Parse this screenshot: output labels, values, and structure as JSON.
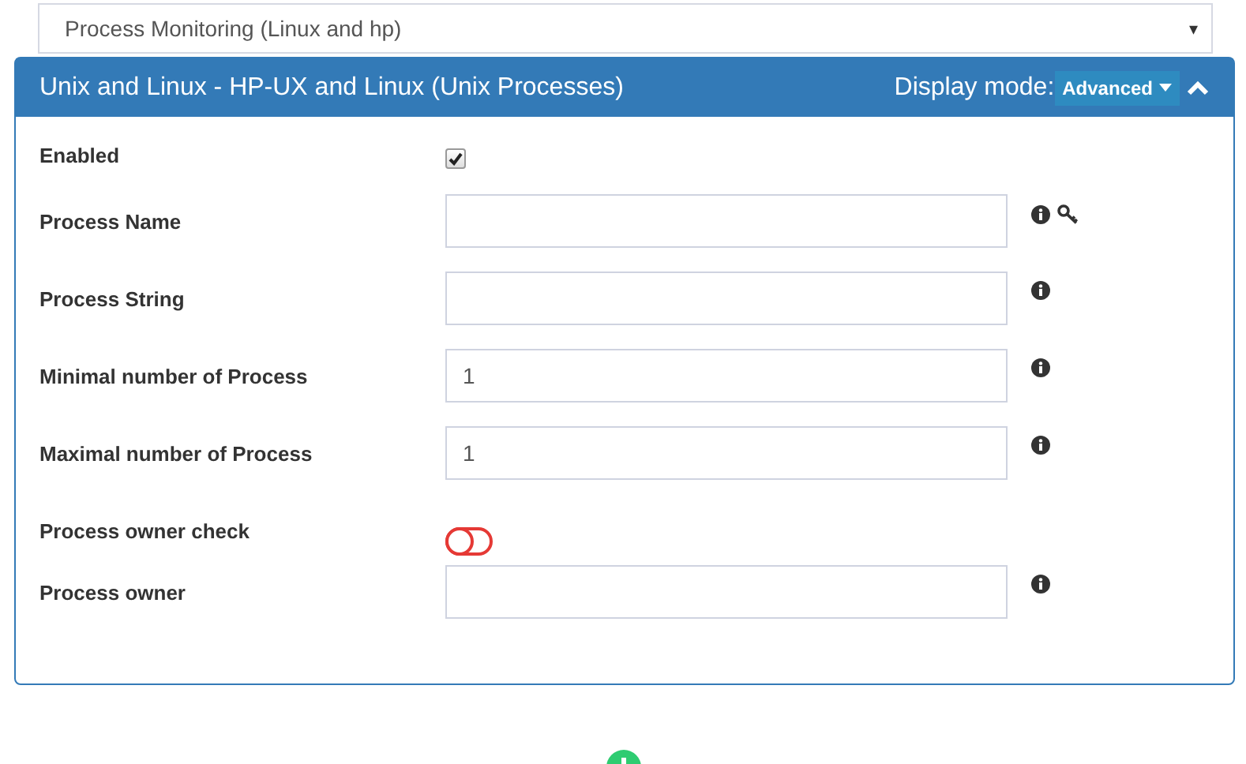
{
  "selector": {
    "value": "Process Monitoring (Linux and hp)",
    "caret": "▾"
  },
  "panel": {
    "title": "Unix and Linux - HP-UX and Linux (Unix Processes)",
    "display_mode_label": "Display mode:",
    "display_mode": "Advanced",
    "expanded": true
  },
  "fields": [
    {
      "kind": "checkbox",
      "label": "Enabled",
      "checked": true
    },
    {
      "kind": "text",
      "label": "Process Name",
      "info": true,
      "key": true
    },
    {
      "kind": "text",
      "label": "Process String",
      "info": true
    },
    {
      "kind": "text",
      "label": "Minimal number of Process",
      "value": "1",
      "info": true
    },
    {
      "kind": "text",
      "label": "Maximal number of Process",
      "value": "1",
      "info": true
    },
    {
      "kind": "toggle",
      "label": "Process owner check",
      "on": false
    },
    {
      "kind": "text",
      "label": "Process owner",
      "info": true
    }
  ]
}
